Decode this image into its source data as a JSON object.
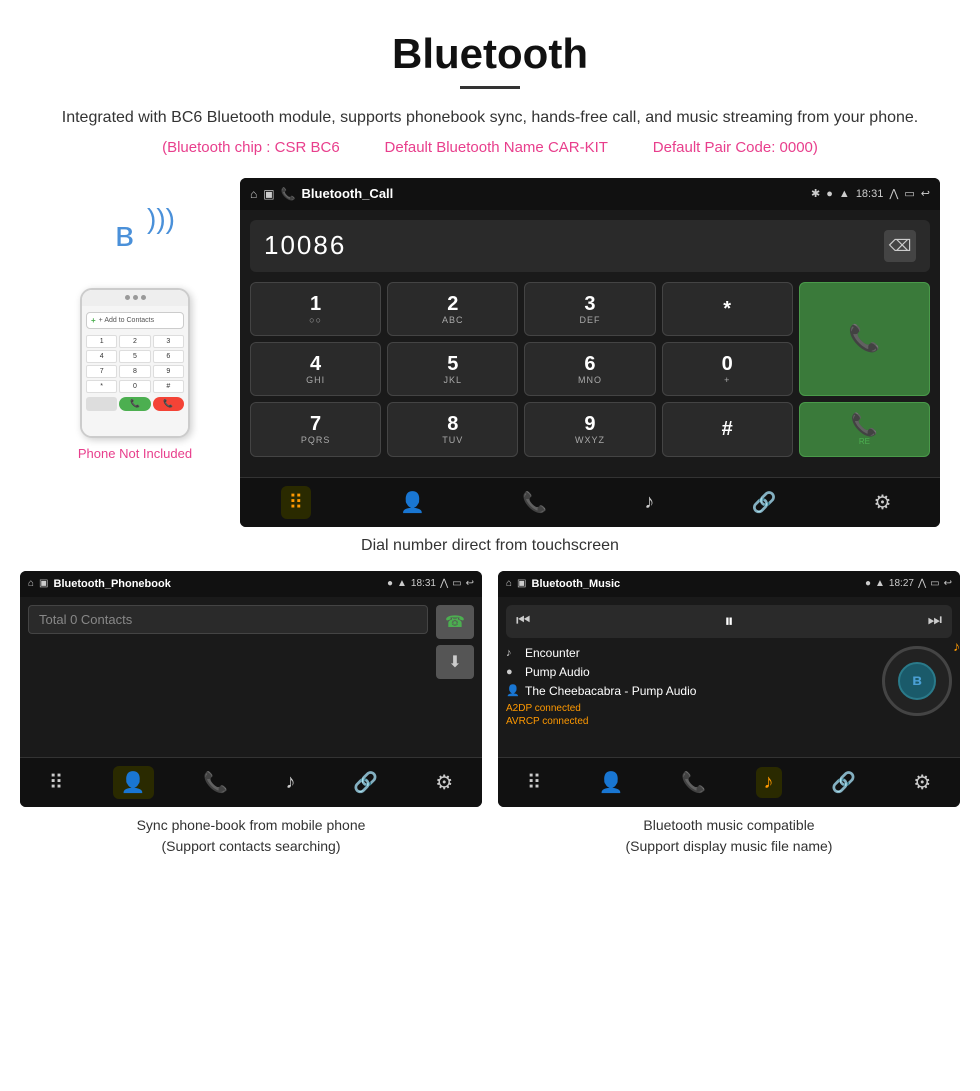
{
  "header": {
    "title": "Bluetooth",
    "subtitle": "Integrated with BC6 Bluetooth module, supports phonebook sync, hands-free call, and music streaming from your phone.",
    "chip_info": {
      "chip": "(Bluetooth chip : CSR BC6",
      "name": "Default Bluetooth Name CAR-KIT",
      "pair_code": "Default Pair Code: 0000)"
    }
  },
  "phone_side": {
    "not_included": "Phone Not Included",
    "add_contacts_label": "+ Add to Contacts",
    "dial_keys": [
      "1",
      "2",
      "3",
      "4",
      "5",
      "6",
      "7",
      "8",
      "9",
      "*",
      "0",
      "#"
    ]
  },
  "main_screen": {
    "app_name": "Bluetooth_Call",
    "time": "18:31",
    "dialed_number": "10086",
    "keys": [
      {
        "main": "1",
        "sub": "○○"
      },
      {
        "main": "2",
        "sub": "ABC"
      },
      {
        "main": "3",
        "sub": "DEF"
      },
      {
        "main": "*",
        "sub": ""
      },
      {
        "main": "☎",
        "sub": "",
        "type": "call"
      },
      {
        "main": "4",
        "sub": "GHI"
      },
      {
        "main": "5",
        "sub": "JKL"
      },
      {
        "main": "6",
        "sub": "MNO"
      },
      {
        "main": "0",
        "sub": "+"
      },
      {
        "main": " ",
        "sub": "",
        "type": "spacer"
      },
      {
        "main": "7",
        "sub": "PQRS"
      },
      {
        "main": "8",
        "sub": "TUV"
      },
      {
        "main": "9",
        "sub": "WXYZ"
      },
      {
        "main": "#",
        "sub": ""
      },
      {
        "main": "☎",
        "sub": "",
        "type": "recall"
      }
    ],
    "nav_icons": [
      "⠿",
      "👤",
      "📞",
      "♪",
      "🔗",
      "⚙"
    ],
    "nav_active": 0
  },
  "caption_main": "Dial number direct from touchscreen",
  "phonebook_screen": {
    "app_name": "Bluetooth_Phonebook",
    "time": "18:31",
    "search_placeholder": "Total 0 Contacts",
    "call_btn_icon": "☎",
    "download_btn_icon": "⬇",
    "nav_icons": [
      "⠿",
      "👤",
      "📞",
      "♪",
      "🔗",
      "⚙"
    ],
    "nav_active": 1
  },
  "music_screen": {
    "app_name": "Bluetooth_Music",
    "time": "18:27",
    "controls": [
      "⏮",
      "⏸",
      "⏭"
    ],
    "track_icon": "♪",
    "album_icon": "●",
    "artist_icon": "👤",
    "track": "Encounter",
    "album": "Pump Audio",
    "artist_track": "The Cheebacabra - Pump Audio",
    "status1": "A2DP connected",
    "status2": "AVRCP connected",
    "bt_logo": "ʙ",
    "nav_icons": [
      "⠿",
      "👤",
      "📞",
      "♪",
      "🔗",
      "⚙"
    ],
    "nav_active": 3
  },
  "caption_phonebook": {
    "line1": "Sync phone-book from mobile phone",
    "line2": "(Support contacts searching)"
  },
  "caption_music": {
    "line1": "Bluetooth music compatible",
    "line2": "(Support display music file name)"
  }
}
